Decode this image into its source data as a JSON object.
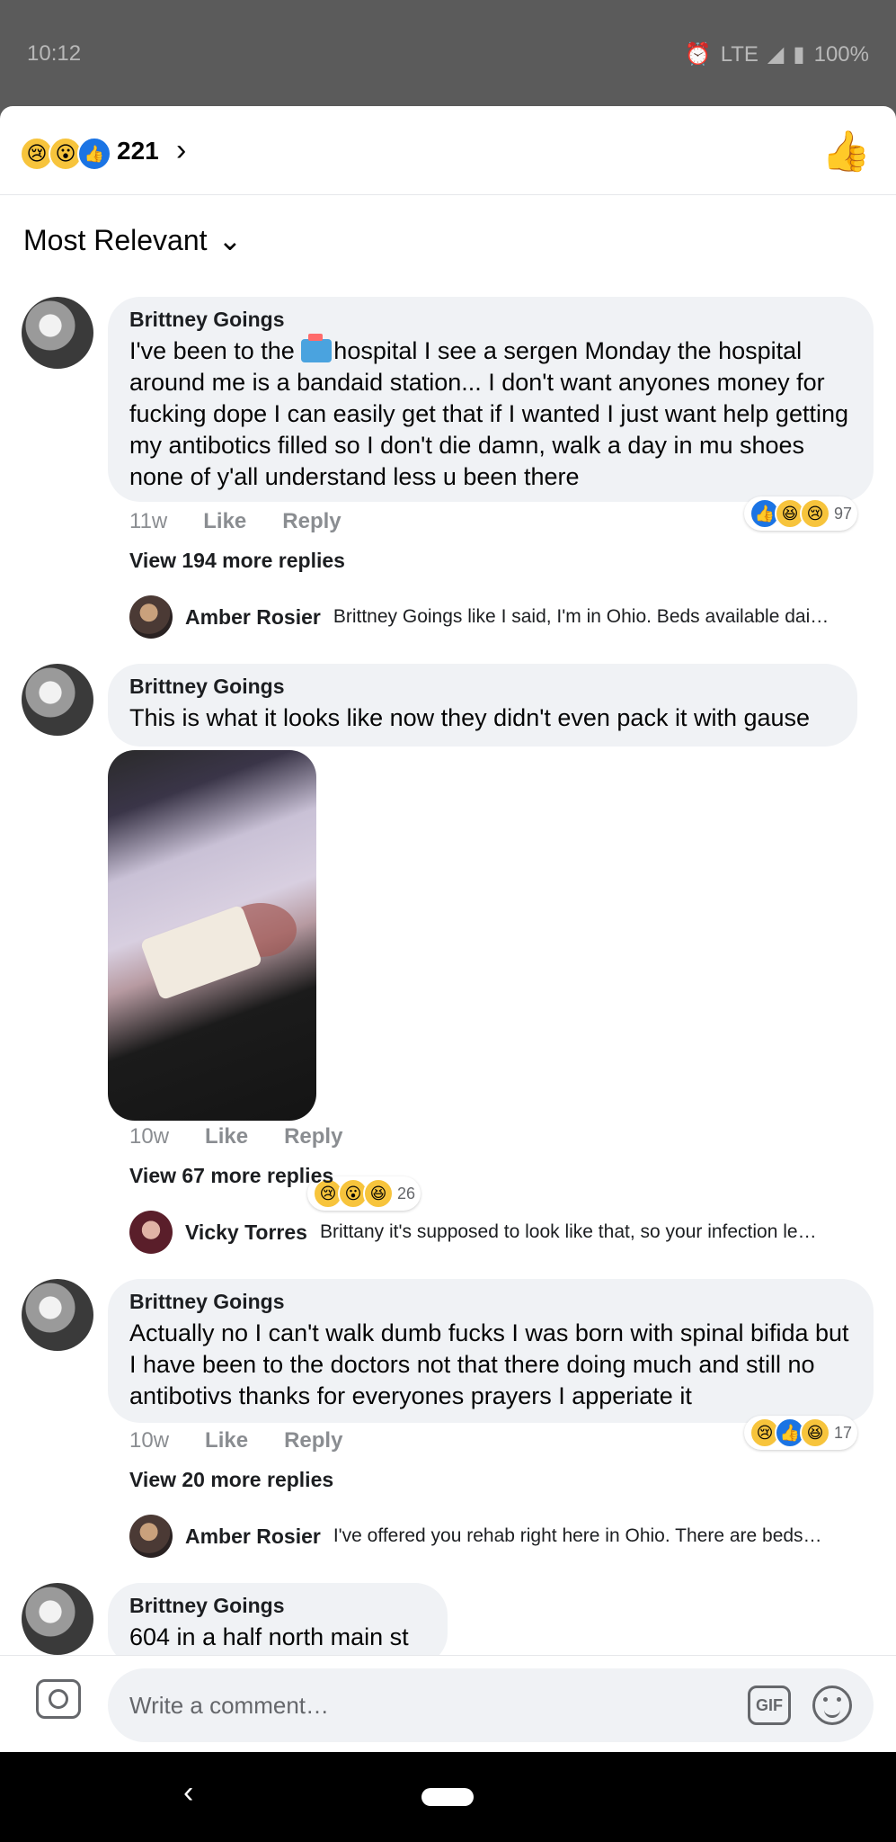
{
  "status_bar": {
    "time": "10:12",
    "network": "LTE",
    "battery": "100%"
  },
  "reactions_header": {
    "count": "221",
    "emojis": [
      "sad",
      "wow",
      "like"
    ]
  },
  "sort": {
    "label": "Most Relevant"
  },
  "comments": [
    {
      "author": "Brittney Goings",
      "text_before_icon": "I've been to the ",
      "text": "hospital I see a sergen Monday the hospital around me is a bandaid station... I don't want anyones money for fucking dope I can easily get that if I wanted I just want help getting my antibotics filled so I don't die damn, walk a day in mu shoes none of y'all understand less u been there",
      "time": "11w",
      "like": "Like",
      "reply": "Reply",
      "reaction_count": "97",
      "view_more": "View 194 more replies",
      "preview": {
        "name": "Amber Rosier",
        "text": "Brittney Goings like I said, I'm in Ohio.  Beds available dai…"
      }
    },
    {
      "author": "Brittney Goings",
      "text": "This is what it looks like now they didn't even pack it with gause",
      "time": "10w",
      "like": "Like",
      "reply": "Reply",
      "reaction_count": "26",
      "view_more": "View 67 more replies",
      "preview": {
        "name": "Vicky Torres",
        "text": "Brittany it's supposed to look like that, so your infection le…"
      }
    },
    {
      "author": "Brittney Goings",
      "text": "Actually no I can't walk dumb fucks I was born with spinal bifida but I have been to the doctors not that there doing much and still no antibotivs thanks for everyones prayers I apperiate it",
      "time": "10w",
      "like": "Like",
      "reply": "Reply",
      "reaction_count": "17",
      "view_more": "View 20 more replies",
      "preview": {
        "name": "Amber Rosier",
        "text": "I've offered you rehab right here in Ohio.  There are beds…"
      }
    },
    {
      "author": "Brittney Goings",
      "text": "604 in a half north main st"
    }
  ],
  "composer": {
    "placeholder": "Write a comment…",
    "gif_label": "GIF"
  },
  "nav": {
    "back": "‹"
  }
}
